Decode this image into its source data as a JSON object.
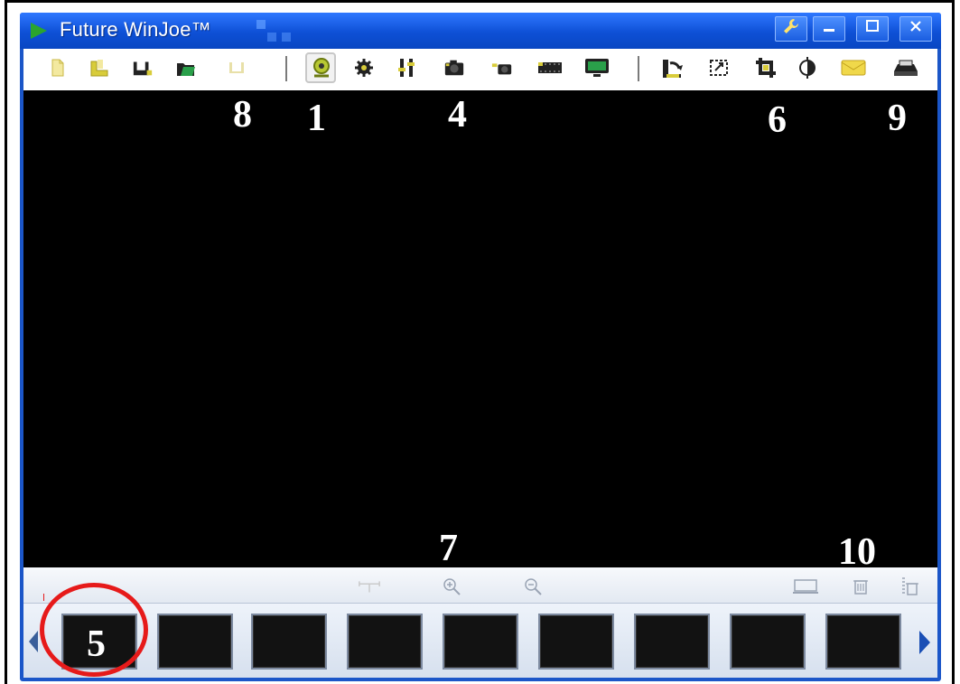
{
  "window": {
    "title": "Future WinJoe™",
    "controls": [
      {
        "name": "tools",
        "glyph": "🔧"
      },
      {
        "name": "minimize",
        "glyph": "—"
      },
      {
        "name": "maximize",
        "glyph": "☐"
      },
      {
        "name": "close",
        "glyph": "✕"
      }
    ]
  },
  "toolbar": {
    "icons": [
      {
        "name": "new-file-icon"
      },
      {
        "name": "open-file-icon"
      },
      {
        "name": "save-as-icon"
      },
      {
        "name": "open-folder-icon"
      },
      {
        "name": "save-icon-disabled"
      },
      {
        "name": "webcam-icon"
      },
      {
        "name": "settings-gear-icon"
      },
      {
        "name": "adjust-sliders-icon"
      },
      {
        "name": "snapshot-camera-icon"
      },
      {
        "name": "burst-camera-icon"
      },
      {
        "name": "video-record-icon"
      },
      {
        "name": "monitor-icon"
      },
      {
        "name": "rotate-icon"
      },
      {
        "name": "fit-window-icon"
      },
      {
        "name": "crop-icon"
      },
      {
        "name": "brightness-icon"
      },
      {
        "name": "envelope-icon"
      },
      {
        "name": "export-icon"
      }
    ]
  },
  "bottom_bar": {
    "icons": [
      {
        "name": "measure-icon"
      },
      {
        "name": "zoom-in-icon"
      },
      {
        "name": "zoom-out-icon"
      },
      {
        "name": "fullscreen-icon"
      },
      {
        "name": "delete-icon"
      },
      {
        "name": "delete-all-icon"
      }
    ]
  },
  "callouts": {
    "c1": "1",
    "c4": "4",
    "c5": "5",
    "c6": "6",
    "c7": "7",
    "c8": "8",
    "c9": "9",
    "c10": "10"
  },
  "colors": {
    "titlebar": "#0e50d6",
    "highlight": "#e61a1a",
    "icon_yellow": "#d9c21a",
    "icon_dark": "#222222"
  }
}
